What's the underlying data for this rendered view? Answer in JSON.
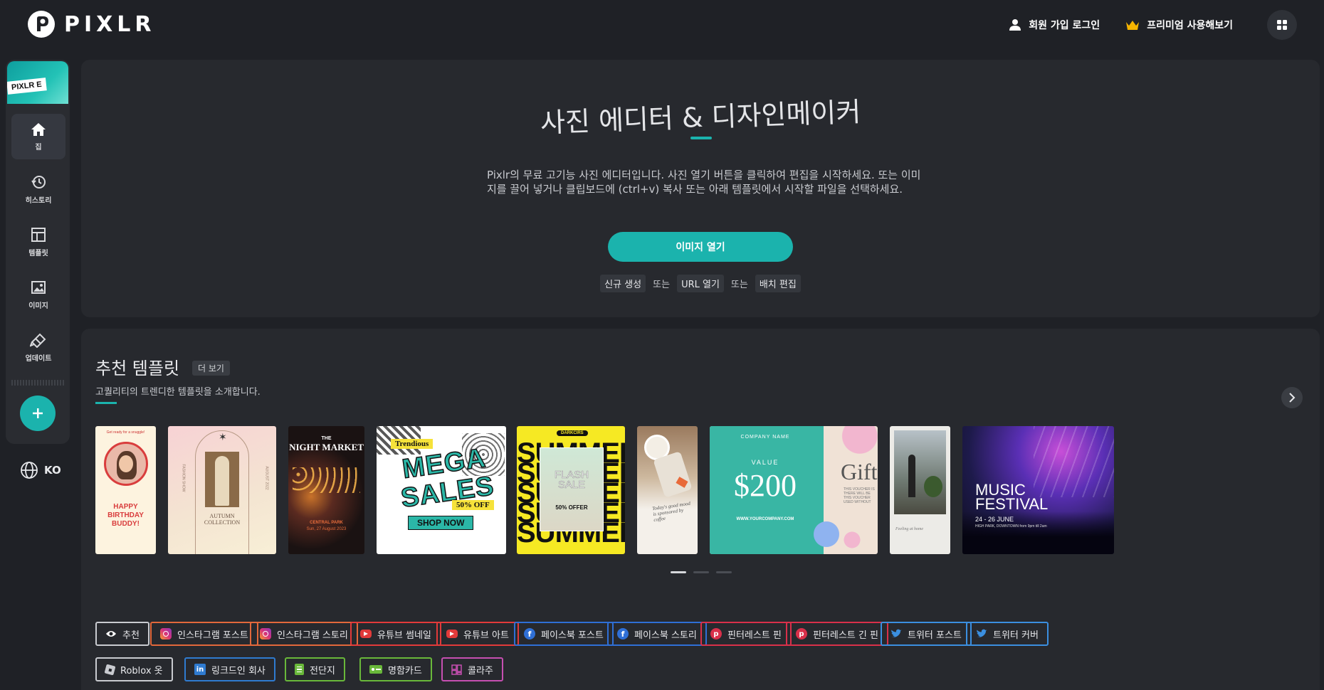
{
  "brand": {
    "name": "PIXLR"
  },
  "header": {
    "auth_label": "회원 가입 로그인",
    "premium_label": "프리미엄 사용해보기"
  },
  "sidebar": {
    "app_tag": "PIXLR E",
    "items": [
      {
        "label": "집",
        "icon": "home-icon"
      },
      {
        "label": "히스토리",
        "icon": "history-icon"
      },
      {
        "label": "템플릿",
        "icon": "template-icon"
      },
      {
        "label": "이미지",
        "icon": "image-icon"
      },
      {
        "label": "업데이트",
        "icon": "megaphone-icon"
      }
    ],
    "language": "KO"
  },
  "hero": {
    "title": "사진 에디터 & 디자인메이커",
    "description": "Pixlr의 무료 고기능 사진 에디터입니다. 사진 열기 버튼을 클릭하여 편집을 시작하세요. 또는 이미지를 끌어 넣거나 클립보드에 (ctrl+v) 복사 또는 아래 템플릿에서 시작할 파일을 선택하세요.",
    "open_button": "이미지 열기",
    "links": {
      "new": "신규 생성",
      "or1": "또는",
      "url": "URL 열기",
      "or2": "또는",
      "batch": "배치 편집"
    }
  },
  "templates": {
    "title": "추천 템플릿",
    "more": "더 보기",
    "subtitle": "고퀄리티의 트렌디한 템플릿을 소개합니다.",
    "cards": {
      "birthday": {
        "top": "Get ready for a snuggle!",
        "text": "HAPPY BIRTHDAY BUDDY!"
      },
      "autumn": {
        "text": "AUTUMN COLLECTION",
        "side_left": "FASHION SHOW",
        "side_right": "AUGUST 2022"
      },
      "night": {
        "the": "THE",
        "title": "NIGHT MARKET",
        "place": "CENTRAL PARK",
        "date": "Sun, 27 August 2023"
      },
      "mega": {
        "tag": "Trendious",
        "line1": "MEGA",
        "line2": "SALES",
        "offer": "50% OFF",
        "cta": "SHOP NOW"
      },
      "summer": {
        "brand": "DARKCIRS",
        "word": "SUMMER",
        "flash": "FLASH SALE",
        "offer": "50% OFFER"
      },
      "food": {
        "note": "Today's good mood is sponsored by coffee"
      },
      "gift": {
        "company": "COMPANY NAME",
        "value": "VALUE",
        "amount": "$200",
        "gift": "Gift",
        "url": "WWW.YOURCOMPANY.COM",
        "note": "THIS VOUCHER IS THERE WILL BE THIS VOUCHER USED WITHOUT"
      },
      "interior": {
        "note": "Feeling at home"
      },
      "festival": {
        "title1": "MUSIC",
        "title2": "FESTIVAL",
        "dates": "24 - 26 JUNE",
        "venue": "HIGH PARK, DOWNTOWN from 9pm till 2am"
      }
    },
    "categories": [
      {
        "label": "추천",
        "icon": "eye-icon",
        "color": "#c9cbd0"
      },
      {
        "label": "인스타그램 포스트",
        "icon": "instagram-icon",
        "color": "#e2683b"
      },
      {
        "label": "인스타그램 스토리",
        "icon": "instagram-icon",
        "color": "#e2683b"
      },
      {
        "label": "유튜브 썸네일",
        "icon": "youtube-icon",
        "color": "#e23a3a"
      },
      {
        "label": "유튜브 아트",
        "icon": "youtube-icon",
        "color": "#e23a3a"
      },
      {
        "label": "페이스북 포스트",
        "icon": "facebook-icon",
        "color": "#2f6fd6"
      },
      {
        "label": "페이스북 스토리",
        "icon": "facebook-icon",
        "color": "#2f6fd6"
      },
      {
        "label": "핀터레스트 핀",
        "icon": "pinterest-icon",
        "color": "#d9304a"
      },
      {
        "label": "핀터레스트 긴 핀",
        "icon": "pinterest-icon",
        "color": "#d9304a"
      },
      {
        "label": "트위터 포스트",
        "icon": "twitter-icon",
        "color": "#3b8fe0"
      },
      {
        "label": "트위터 커버",
        "icon": "twitter-icon",
        "color": "#3b8fe0"
      },
      {
        "label": "Roblox 옷",
        "icon": "roblox-icon",
        "color": "#c9cbd0"
      },
      {
        "label": "링크드인 회사",
        "icon": "linkedin-icon",
        "color": "#2f7bd0"
      },
      {
        "label": "전단지",
        "icon": "flyer-icon",
        "color": "#69b83a"
      },
      {
        "label": "명함카드",
        "icon": "business-card-icon",
        "color": "#69b83a"
      },
      {
        "label": "콜라주",
        "icon": "collage-icon",
        "color": "#c64fb1"
      }
    ]
  },
  "colors": {
    "accent": "#1bb3ad",
    "bg": "#1f2126",
    "panel": "#27292e"
  }
}
